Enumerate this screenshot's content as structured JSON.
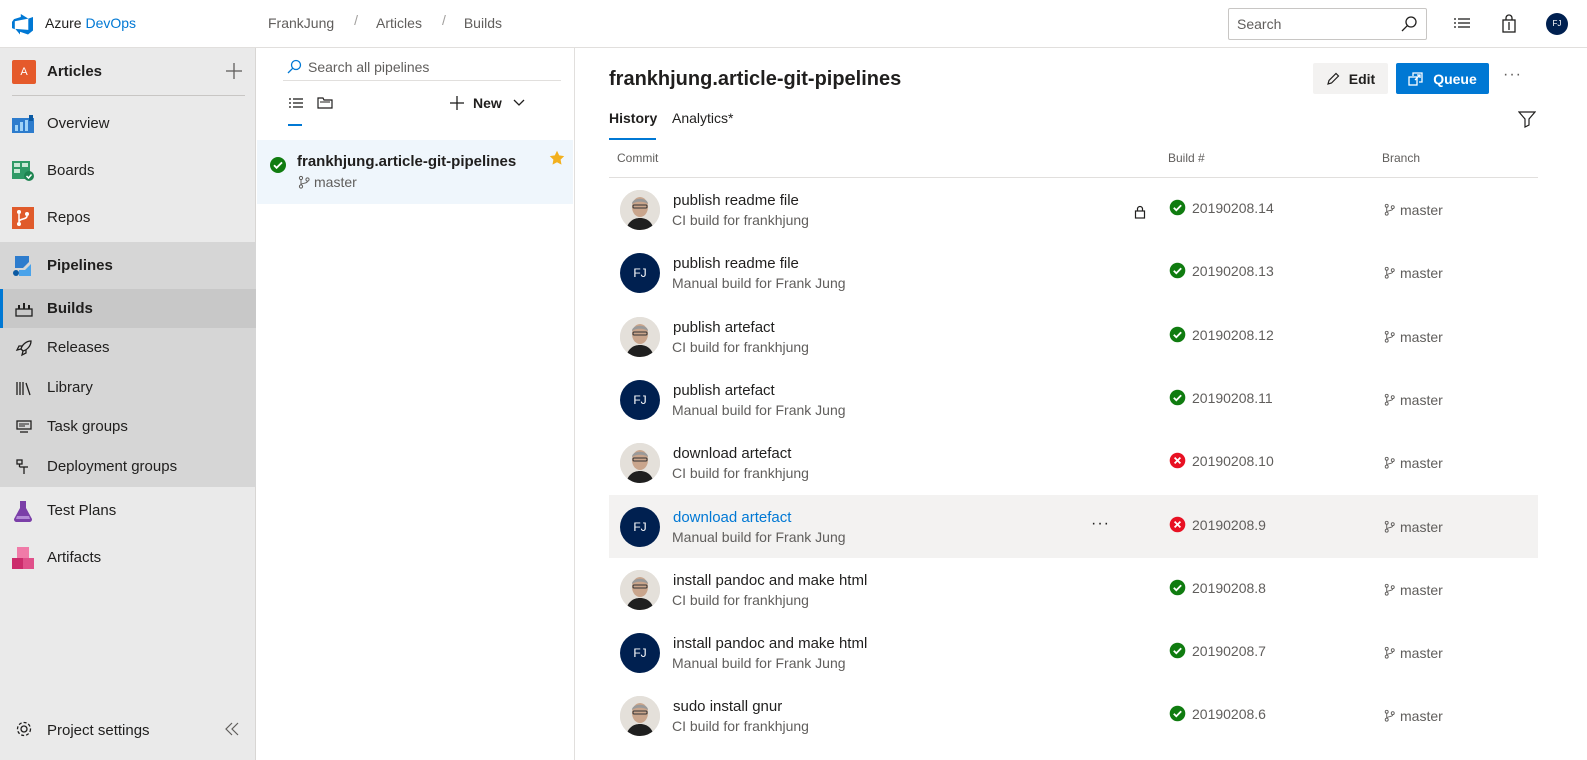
{
  "topbar": {
    "brand_plain": "Azure ",
    "brand_accent": "DevOps",
    "breadcrumbs": [
      "FrankJung",
      "Articles",
      "Builds"
    ],
    "breadcrumb_separator": "/",
    "search_placeholder": "Search",
    "user_initials": "FJ"
  },
  "leftnav": {
    "project_initial": "A",
    "project_name": "Articles",
    "items": [
      {
        "label": "Overview",
        "icon": "overview-icon"
      },
      {
        "label": "Boards",
        "icon": "boards-icon"
      },
      {
        "label": "Repos",
        "icon": "repos-icon"
      },
      {
        "label": "Pipelines",
        "icon": "pipelines-icon"
      }
    ],
    "pipeline_subitems": [
      {
        "label": "Builds",
        "icon": "builds-icon",
        "active": true
      },
      {
        "label": "Releases",
        "icon": "rocket-icon"
      },
      {
        "label": "Library",
        "icon": "library-icon"
      },
      {
        "label": "Task groups",
        "icon": "task-groups-icon"
      },
      {
        "label": "Deployment groups",
        "icon": "deployment-groups-icon"
      }
    ],
    "lower_items": [
      {
        "label": "Test Plans",
        "icon": "flask-icon"
      },
      {
        "label": "Artifacts",
        "icon": "artifacts-icon"
      }
    ],
    "settings_label": "Project settings"
  },
  "pipelines_panel": {
    "search_placeholder": "Search all pipelines",
    "new_label": "New",
    "selected_pipeline": {
      "name": "frankhjung.article-git-pipelines",
      "branch": "master",
      "favorite": true
    }
  },
  "main": {
    "title": "frankhjung.article-git-pipelines",
    "edit_label": "Edit",
    "queue_label": "Queue",
    "more_label": "···",
    "tabs": [
      {
        "label": "History",
        "selected": true
      },
      {
        "label": "Analytics*",
        "selected": false
      }
    ],
    "columns": {
      "commit": "Commit",
      "build": "Build #",
      "branch": "Branch"
    },
    "builds": [
      {
        "message": "publish readme file",
        "sub": "CI build for frankhjung",
        "avatar": "photo",
        "locked": true,
        "status": "success",
        "number": "20190208.14",
        "branch": "master"
      },
      {
        "message": "publish readme file",
        "sub": "Manual build for Frank Jung",
        "avatar": "FJ",
        "status": "success",
        "number": "20190208.13",
        "branch": "master"
      },
      {
        "message": "publish artefact",
        "sub": "CI build for frankhjung",
        "avatar": "photo",
        "status": "success",
        "number": "20190208.12",
        "branch": "master"
      },
      {
        "message": "publish artefact",
        "sub": "Manual build for Frank Jung",
        "avatar": "FJ",
        "status": "success",
        "number": "20190208.11",
        "branch": "master"
      },
      {
        "message": "download artefact",
        "sub": "CI build for frankhjung",
        "avatar": "photo",
        "status": "failed",
        "number": "20190208.10",
        "branch": "master"
      },
      {
        "message": "download artefact",
        "sub": "Manual build for Frank Jung",
        "avatar": "FJ",
        "status": "failed",
        "number": "20190208.9",
        "branch": "master",
        "hovered": true
      },
      {
        "message": "install pandoc and make html",
        "sub": "CI build for frankhjung",
        "avatar": "photo",
        "status": "success",
        "number": "20190208.8",
        "branch": "master"
      },
      {
        "message": "install pandoc and make html",
        "sub": "Manual build for Frank Jung",
        "avatar": "FJ",
        "status": "success",
        "number": "20190208.7",
        "branch": "master"
      },
      {
        "message": "sudo install gnur",
        "sub": "CI build for frankhjung",
        "avatar": "photo",
        "status": "success",
        "number": "20190208.6",
        "branch": "master"
      }
    ]
  },
  "colors": {
    "accent": "#0078d4",
    "success": "#107c10",
    "failed": "#e81123",
    "nav_bg": "#eaeaea",
    "selected_item_bg": "#eff6fc"
  }
}
